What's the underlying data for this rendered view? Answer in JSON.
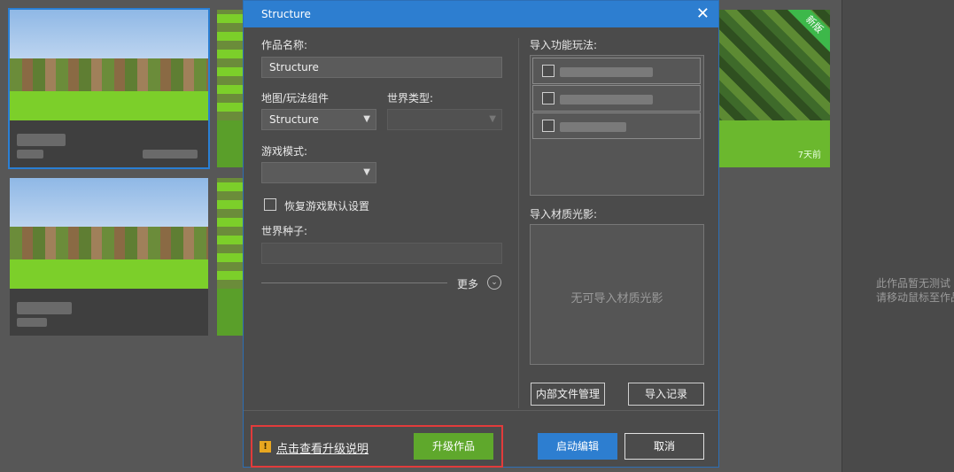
{
  "dialog": {
    "title": "Structure",
    "close_glyph": "✕",
    "work_name_label": "作品名称:",
    "work_name_value": "Structure",
    "map_component_label": "地图/玩法组件",
    "map_component_value": "Structure",
    "world_type_label": "世界类型:",
    "world_type_value": "",
    "game_mode_label": "游戏模式:",
    "game_mode_value": "",
    "restore_default_label": "恢复游戏默认设置",
    "world_seed_label": "世界种子:",
    "world_seed_value": "",
    "more_label": "更多",
    "import_features_label": "导入功能玩法:",
    "import_shader_label": "导入材质光影:",
    "no_shader_text": "无可导入材质光影",
    "internal_files_button": "内部文件管理",
    "import_log_button": "导入记录",
    "upgrade_notes_link": "点击查看升级说明",
    "upgrade_button": "升级作品",
    "launch_edit_button": "启动编辑",
    "cancel_button": "取消",
    "warn_glyph": "!",
    "select_arrow": "▼",
    "more_arrow": "⌄"
  },
  "background": {
    "new_badge": "新版",
    "card_time": "7天前",
    "right_hint_line1": "此作品暂无测试",
    "right_hint_line2": "请移动鼠标至作品"
  },
  "colors": {
    "accent_blue": "#2d7ed0",
    "accent_green": "#5fa82c",
    "highlight_red": "#e23b3b",
    "warning_yellow": "#e8a720"
  }
}
